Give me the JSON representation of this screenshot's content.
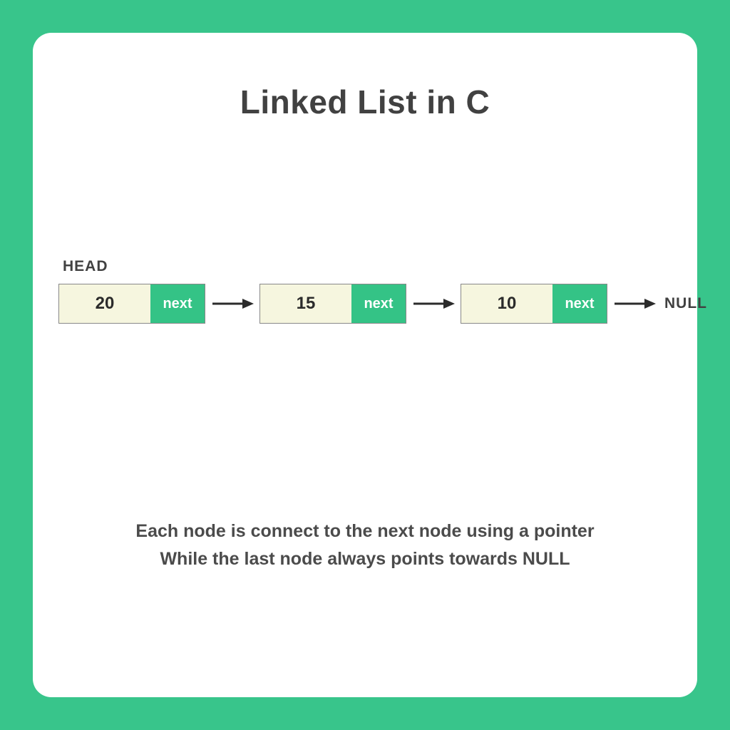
{
  "title": "Linked List in C",
  "head_label": "HEAD",
  "null_label": "NULL",
  "next_label": "next",
  "nodes": [
    {
      "value": "20"
    },
    {
      "value": "15"
    },
    {
      "value": "10"
    }
  ],
  "caption": {
    "line1": "Each node is connect to the next node using a pointer",
    "line2": "While the last node always points towards NULL"
  },
  "colors": {
    "frame": "#38c58b",
    "card": "#ffffff",
    "node_data_bg": "#f6f6df",
    "node_next_bg": "#34c386",
    "text": "#414141"
  }
}
